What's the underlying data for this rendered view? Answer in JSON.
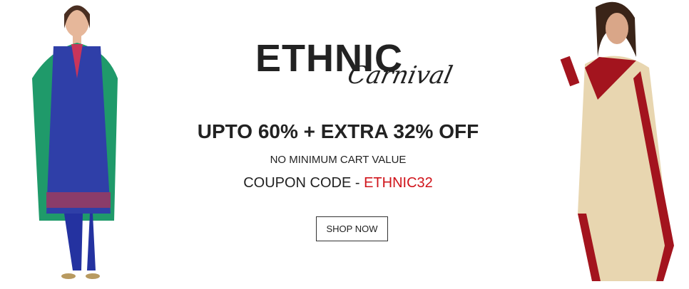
{
  "logo": {
    "main": "ETHNIC",
    "script": "Carnival"
  },
  "headline": "UPTO 60% + EXTRA 32% OFF",
  "subtext": "NO MINIMUM CART VALUE",
  "coupon": {
    "label": "COUPON CODE - ",
    "code": "ETHNIC32"
  },
  "cta": "SHOP NOW",
  "colors": {
    "accent": "#d0141b",
    "text": "#222222",
    "kurta": "#2f3fa8",
    "dupatta": "#1f9a6a",
    "saree": "#e8d6b0",
    "saree_border": "#a3141e"
  }
}
